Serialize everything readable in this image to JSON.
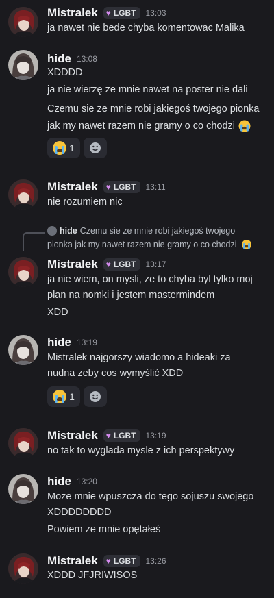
{
  "users": {
    "mistralek": {
      "name": "Mistralek",
      "tag": "LGBT"
    },
    "hide": {
      "name": "hide"
    }
  },
  "messages": [
    {
      "author": "Mistralek",
      "tag": "LGBT",
      "time": "13:03",
      "lines": [
        "ja nawet nie bede chyba komentowac Malika"
      ]
    },
    {
      "author": "hide",
      "time": "13:08",
      "lines": [
        "XDDDD",
        "ja nie wierzę ze mnie nawet na poster nie dali",
        "Czemu sie ze mnie robi jakiegoś twojego pionka",
        "jak my nawet razem nie gramy o co chodzi"
      ],
      "reaction_count": "1"
    },
    {
      "author": "Mistralek",
      "tag": "LGBT",
      "time": "13:11",
      "lines": [
        "nie rozumiem nic"
      ]
    },
    {
      "reply_author": "hide",
      "reply_text_1": "Czemu sie ze mnie robi jakiegoś twojego",
      "reply_text_2": "pionka jak my nawet razem nie gramy o co chodzi",
      "author": "Mistralek",
      "tag": "LGBT",
      "time": "13:17",
      "lines": [
        "ja nie wiem, on mysli, ze to chyba byl tylko moj",
        "plan na nomki i jestem mastermindem",
        "XDD"
      ]
    },
    {
      "author": "hide",
      "time": "13:19",
      "lines": [
        "Mistralek najgorszy wiadomo a hideaki za",
        "nudna zeby cos wymyślić XDD"
      ],
      "reaction_count": "1"
    },
    {
      "author": "Mistralek",
      "tag": "LGBT",
      "time": "13:19",
      "lines": [
        "no tak to wyglada mysle z ich perspektywy"
      ]
    },
    {
      "author": "hide",
      "time": "13:20",
      "lines": [
        "Moze mnie wpuszcza do tego sojuszu swojego",
        "XDDDDDDDD",
        "Powiem ze mnie opętałeś"
      ]
    },
    {
      "author": "Mistralek",
      "tag": "LGBT",
      "time": "13:26",
      "lines": [
        "XDDD JFJRIWISOS"
      ]
    }
  ],
  "icons": {
    "tag": "heart-icon",
    "reaction": "loudly-crying-face-icon",
    "add_reaction": "add-reaction-icon"
  },
  "colors": {
    "background": "#1a1a1e",
    "tag_heart": "#d68cf0",
    "reaction_bg": "#2a2b32"
  }
}
